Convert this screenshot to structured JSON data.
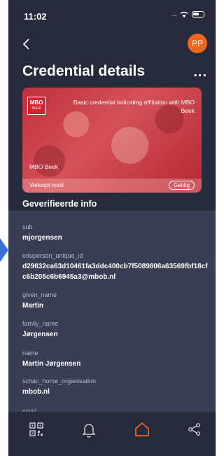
{
  "status_bar": {
    "time": "11:02",
    "signal": "...."
  },
  "header": {
    "avatar_initials": "PP",
    "title": "Credential details",
    "more_label": "..."
  },
  "card": {
    "logo_text": "MBO",
    "logo_subtext": "BEEK",
    "description": "Basic credential indicating affiliation with MBO Beek",
    "issuer": "MBO Beek",
    "expiry": "Verloopt nooit",
    "status": "Geldig"
  },
  "verified_info": {
    "heading": "Geverifieerde info",
    "fields": [
      {
        "label": "sub",
        "value": "mjorgensen"
      },
      {
        "label": "eduperson_unique_id",
        "value": "d29632ca63d10461fa3ddc400cb7f5089806a63569fbf18cfc6b205c6b6945a3@mbob.nl"
      },
      {
        "label": "given_name",
        "value": "Martin"
      },
      {
        "label": "family_name",
        "value": "Jørgensen"
      },
      {
        "label": "name",
        "value": "Martin Jørgensen"
      },
      {
        "label": "schac_home_organisation",
        "value": "mbob.nl"
      }
    ],
    "partial_next_label": "email"
  },
  "colors": {
    "accent": "#f0661e",
    "background": "#262a3b",
    "panel": "#3a3e54",
    "card": "#c0303c"
  },
  "nav": [
    {
      "name": "qr-code-icon",
      "active": false
    },
    {
      "name": "bell-icon",
      "active": false
    },
    {
      "name": "home-icon",
      "active": true
    },
    {
      "name": "share-icon",
      "active": false
    }
  ]
}
